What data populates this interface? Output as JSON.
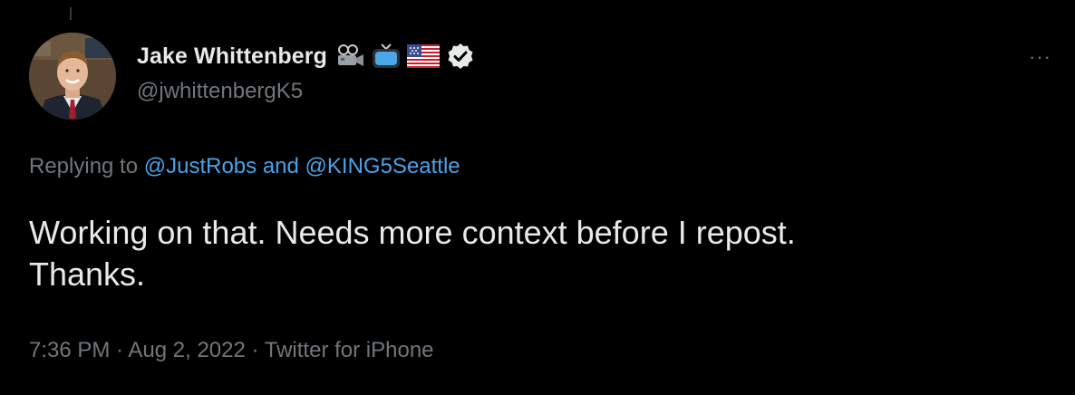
{
  "author": {
    "display_name": "Jake Whittenberg",
    "handle": "@jwhittenbergK5",
    "badges": [
      "movie-camera-icon",
      "television-icon",
      "us-flag-icon",
      "verified-badge-icon"
    ]
  },
  "reply_context": {
    "prefix": "Replying to ",
    "mention_1": "@JustRobs",
    "conjunction": " and ",
    "mention_2": "@KING5Seattle"
  },
  "tweet": {
    "line_1": "Working on that. Needs more context before I repost.",
    "line_2": "Thanks."
  },
  "meta": {
    "time": "7:36 PM",
    "separator": " · ",
    "date": "Aug 2, 2022",
    "source": "Twitter for iPhone"
  },
  "more_button": "···",
  "colors": {
    "background": "#000000",
    "text": "#e7e9ea",
    "secondary": "#71767b",
    "link": "#4aa3e8"
  }
}
